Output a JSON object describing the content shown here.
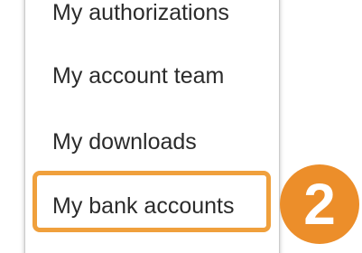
{
  "menu": {
    "items": [
      {
        "label": "My authorizations"
      },
      {
        "label": "My account team"
      },
      {
        "label": "My downloads"
      },
      {
        "label": "My bank accounts"
      }
    ]
  },
  "annotation": {
    "step_number": "2",
    "highlight_color": "#f0a03c",
    "badge_color": "#ec8e2a"
  }
}
